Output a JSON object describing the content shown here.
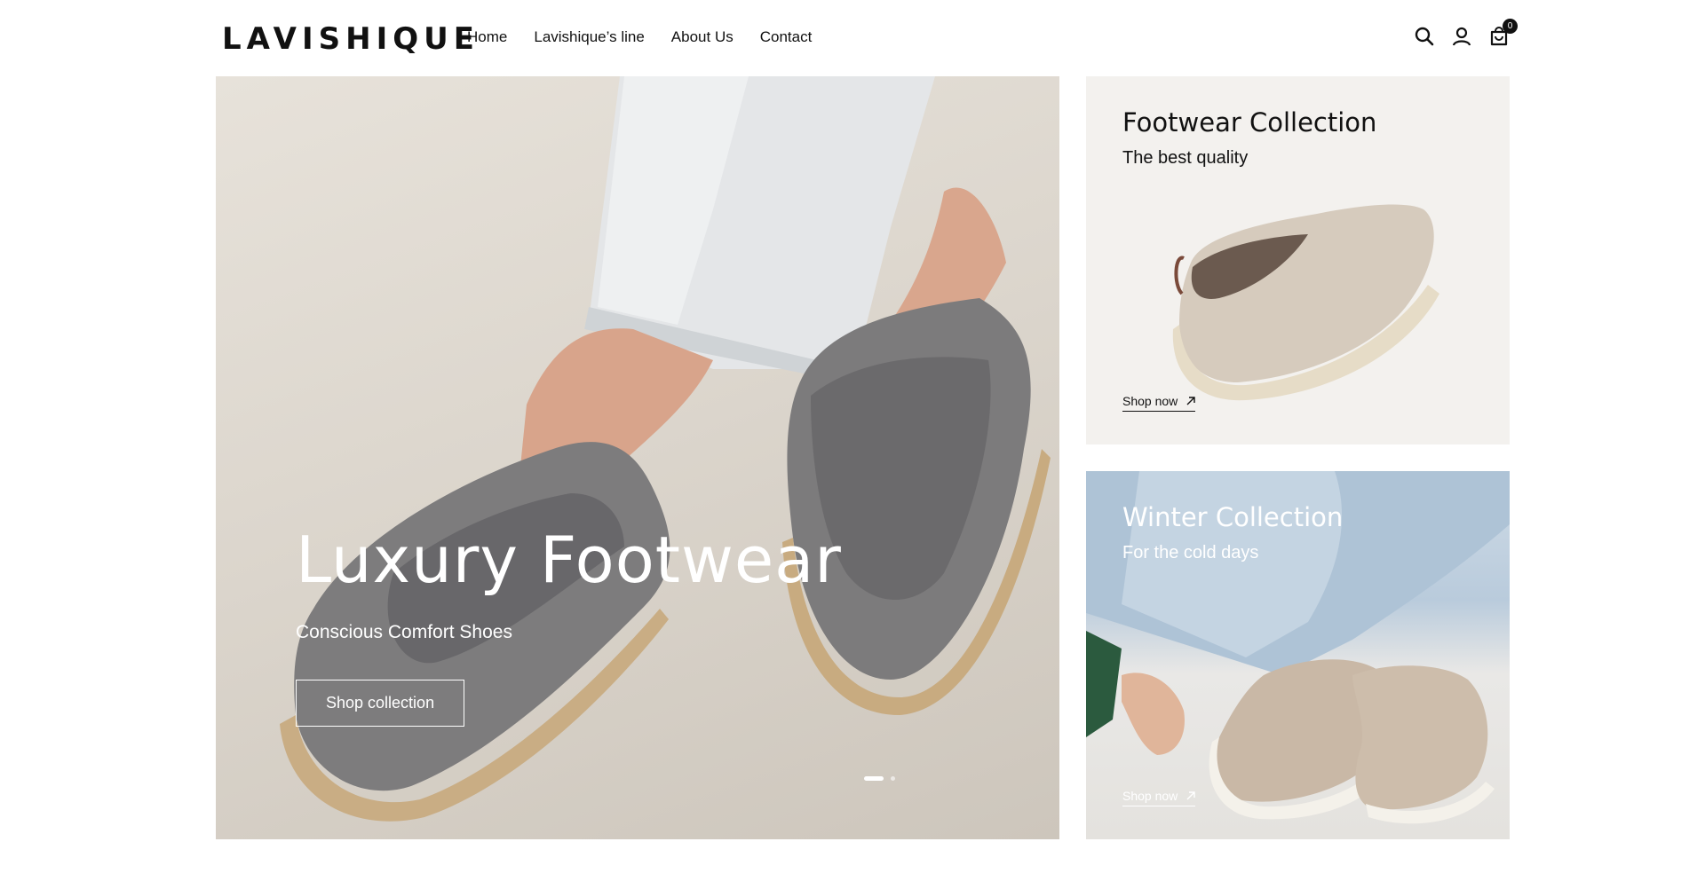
{
  "brand": {
    "logo": "LAVISHIQUE"
  },
  "nav": {
    "items": [
      "Home",
      "Lavishique’s line",
      "About Us",
      "Contact"
    ]
  },
  "header_icons": {
    "search": "search-icon",
    "account": "account-icon",
    "cart": "cart-icon",
    "cart_count": "0"
  },
  "hero": {
    "title": "Luxury Footwear",
    "subtitle": "Conscious Comfort Shoes",
    "button_label": "Shop collection",
    "slides_total": 2,
    "active_slide": 1
  },
  "cards": [
    {
      "title": "Footwear Collection",
      "subtitle": "The best quality",
      "link_label": "Shop now",
      "link_icon": "arrow-up-right-icon"
    },
    {
      "title": "Winter Collection",
      "subtitle": "For the cold days",
      "link_label": "Shop now",
      "link_icon": "arrow-up-right-icon"
    }
  ],
  "colors": {
    "text": "#111111",
    "background": "#ffffff",
    "card_bg": "#f3f1ee"
  }
}
